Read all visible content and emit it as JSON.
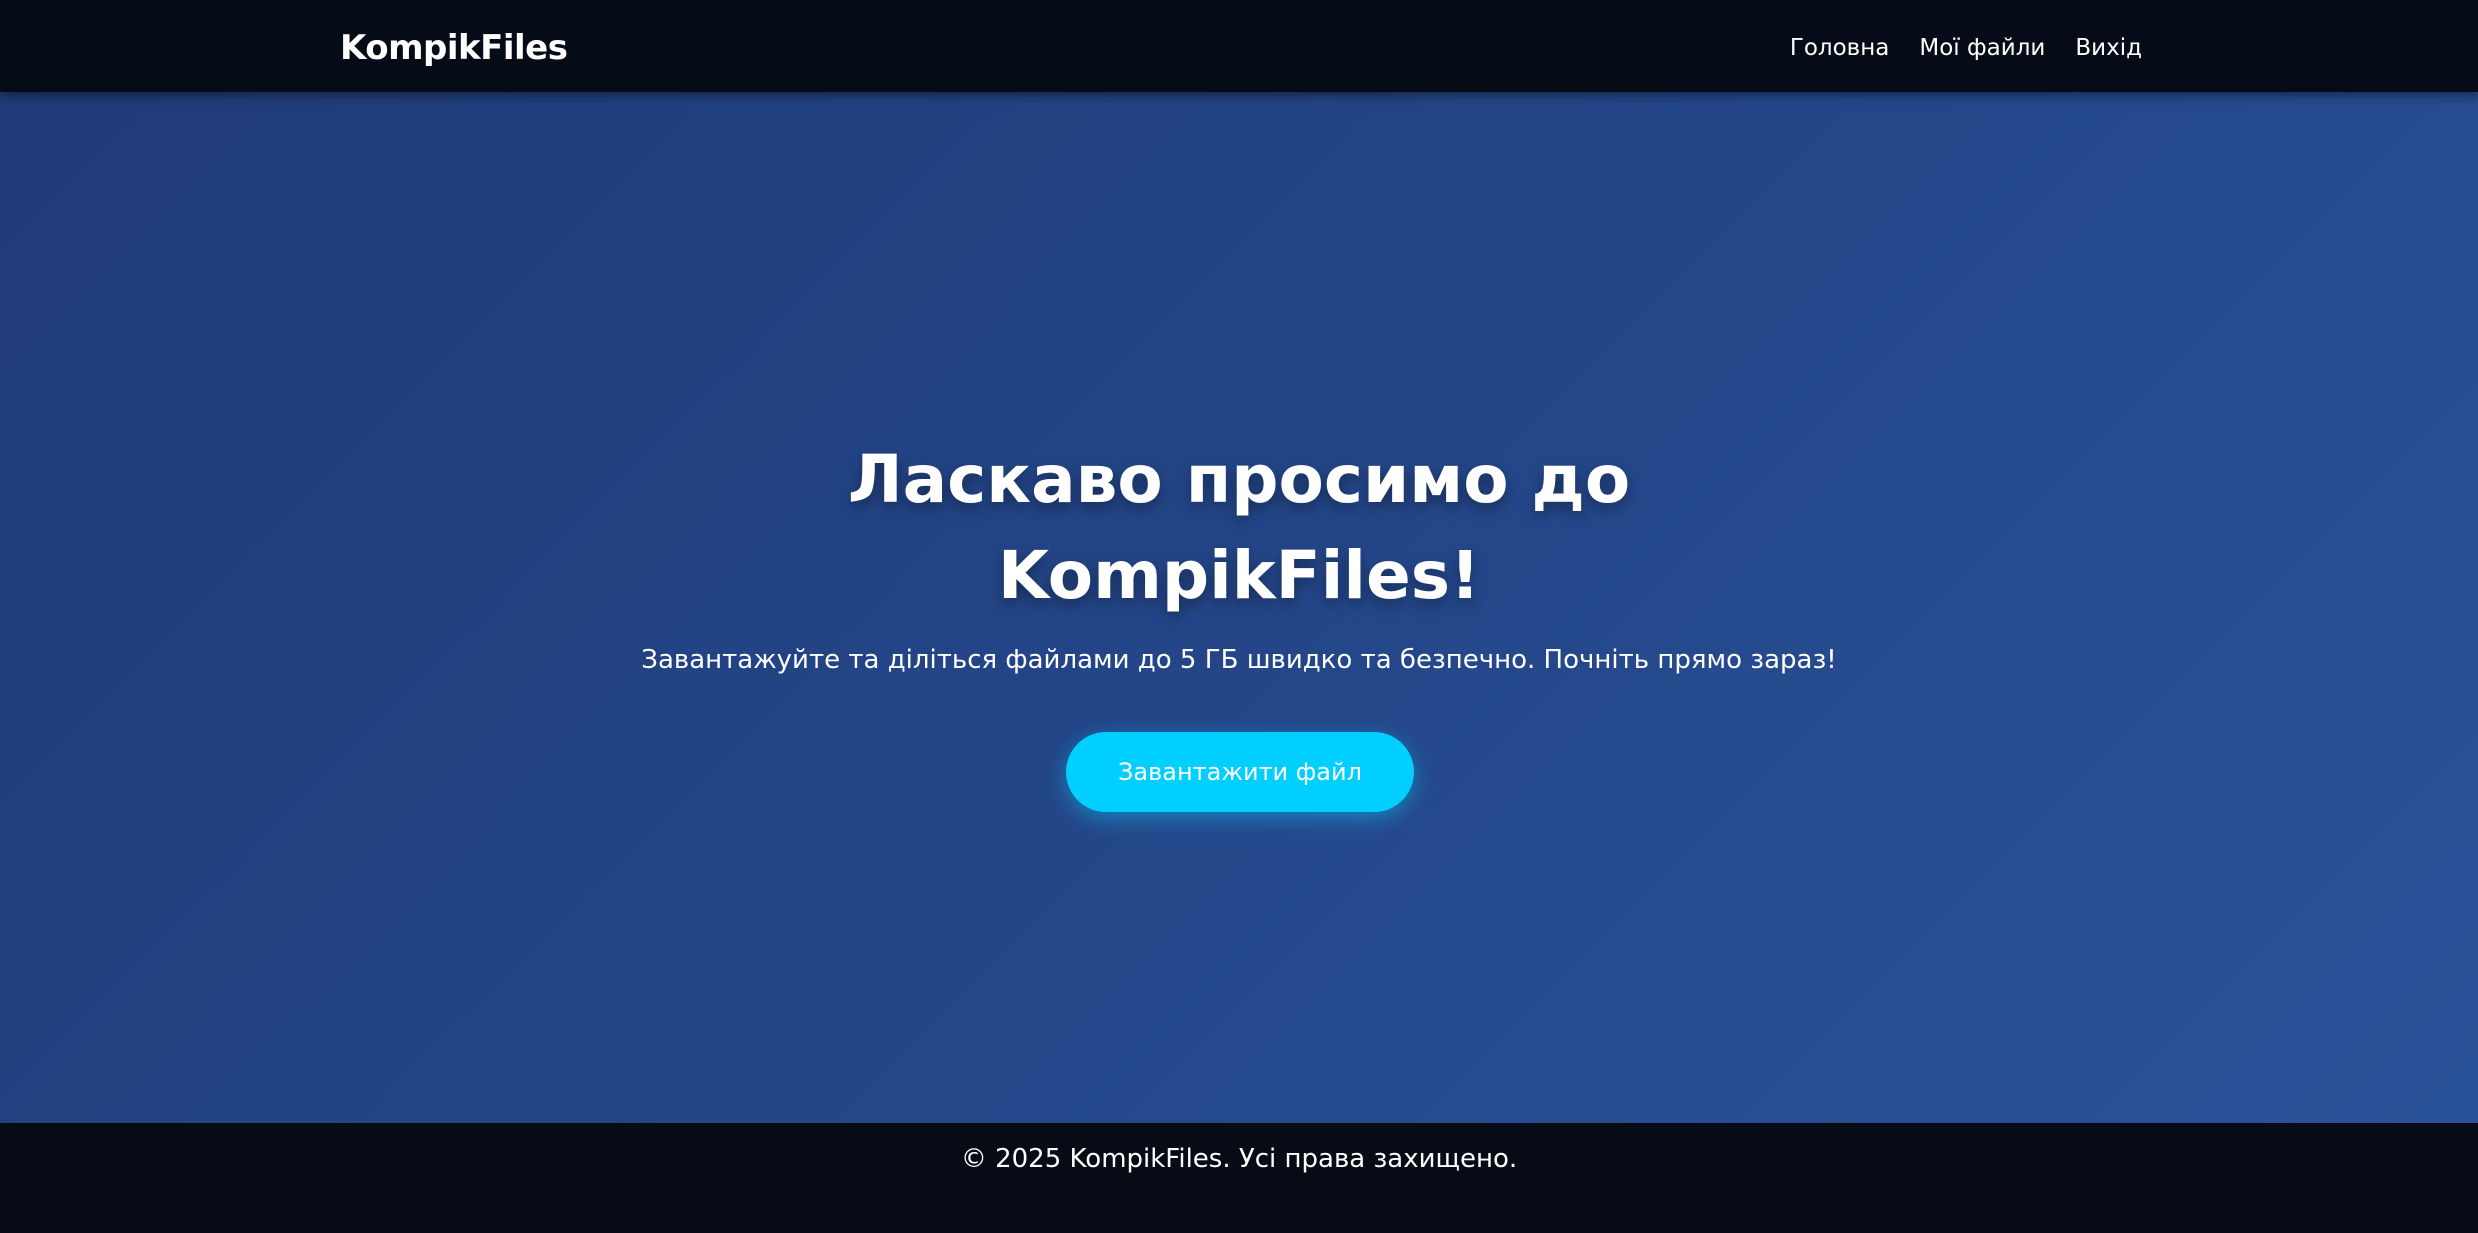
{
  "header": {
    "brand": "KompikFiles",
    "nav": [
      {
        "label": "Головна"
      },
      {
        "label": "Мої файли"
      },
      {
        "label": "Вихід"
      }
    ]
  },
  "hero": {
    "title": "Ласкаво просимо до KompikFiles!",
    "subtitle": "Завантажуйте та діліться файлами до 5 ГБ швидко та безпечно. Почніть прямо зараз!",
    "button_label": "Завантажити файл"
  },
  "footer": {
    "text": "© 2025 KompikFiles. Усі права захищено."
  },
  "colors": {
    "header_bg": "#060b18",
    "hero_gradient_start": "#1f3b78",
    "hero_gradient_end": "#2a5298",
    "accent": "#00cfff",
    "footer_bg": "#060b16",
    "text": "#ffffff"
  }
}
